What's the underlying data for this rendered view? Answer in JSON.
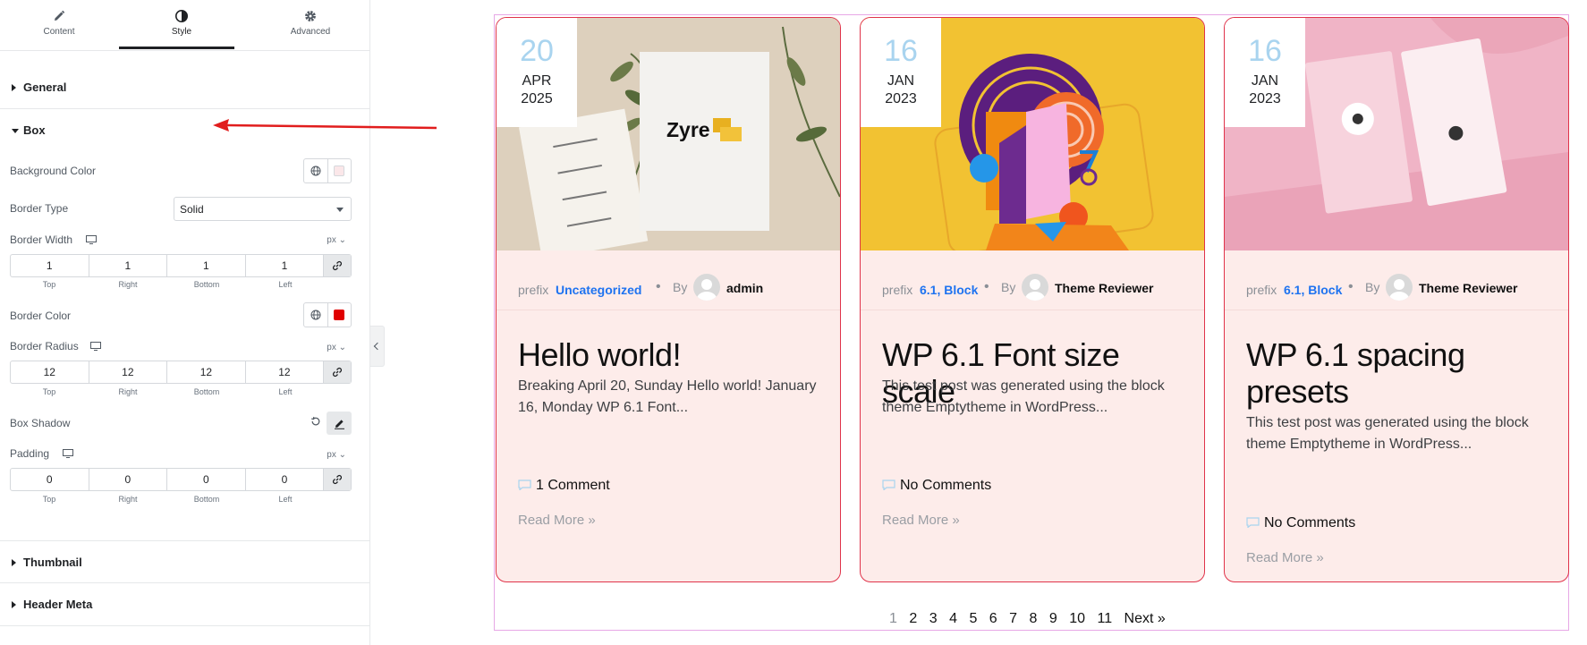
{
  "panel": {
    "tabs": [
      {
        "label": "Content",
        "icon": "pencil-icon"
      },
      {
        "label": "Style",
        "icon": "contrast-icon"
      },
      {
        "label": "Advanced",
        "icon": "gear-icon"
      }
    ],
    "active_tab": "Style",
    "sections": {
      "general": "General",
      "box": "Box",
      "thumbnail": "Thumbnail",
      "header_meta": "Header Meta"
    },
    "box": {
      "background_color_label": "Background Color",
      "background_color": "#fbe7e9",
      "border_type_label": "Border Type",
      "border_type_value": "Solid",
      "border_width_label": "Border Width",
      "border_width_unit": "px",
      "border_width": [
        "1",
        "1",
        "1",
        "1"
      ],
      "border_color_label": "Border Color",
      "border_color": "#e00000",
      "border_radius_label": "Border Radius",
      "border_radius_unit": "px",
      "border_radius": [
        "12",
        "12",
        "12",
        "12"
      ],
      "box_shadow_label": "Box Shadow",
      "padding_label": "Padding",
      "padding_unit": "px",
      "padding": [
        "0",
        "0",
        "0",
        "0"
      ],
      "dim_labels": [
        "Top",
        "Right",
        "Bottom",
        "Left"
      ]
    }
  },
  "posts": [
    {
      "day": "20",
      "month": "APR",
      "year": "2025",
      "prefix": "prefix",
      "categories": "Uncategorized",
      "by": "By",
      "author": "admin",
      "title": "Hello world!",
      "excerpt": "Breaking April 20, Sunday Hello world! January 16, Monday WP 6.1 Font...",
      "comments": "1 Comment",
      "read_more": "Read More »"
    },
    {
      "day": "16",
      "month": "JAN",
      "year": "2023",
      "prefix": "prefix",
      "categories": "6.1, Block",
      "by": "By",
      "author": "Theme Reviewer",
      "title": "WP 6.1 Font size scale",
      "excerpt": "This test post was generated using the block theme Emptytheme in WordPress...",
      "comments": "No Comments",
      "read_more": "Read More »"
    },
    {
      "day": "16",
      "month": "JAN",
      "year": "2023",
      "prefix": "prefix",
      "categories": "6.1, Block",
      "by": "By",
      "author": "Theme Reviewer",
      "title": "WP 6.1 spacing presets",
      "excerpt": "This test post was generated using the block theme Emptytheme in WordPress...",
      "comments": "No Comments",
      "read_more": "Read More »"
    }
  ],
  "pagination": {
    "pages": [
      "1",
      "2",
      "3",
      "4",
      "5",
      "6",
      "7",
      "8",
      "9",
      "10",
      "11"
    ],
    "current": "1",
    "next": "Next »"
  },
  "thumbnail_logo": "Zyre",
  "colors": {
    "accent_link": "#1e73f0",
    "card_border": "#e0334a",
    "card_bg": "#fdecea",
    "annotation_arrow": "#e11d1d"
  }
}
